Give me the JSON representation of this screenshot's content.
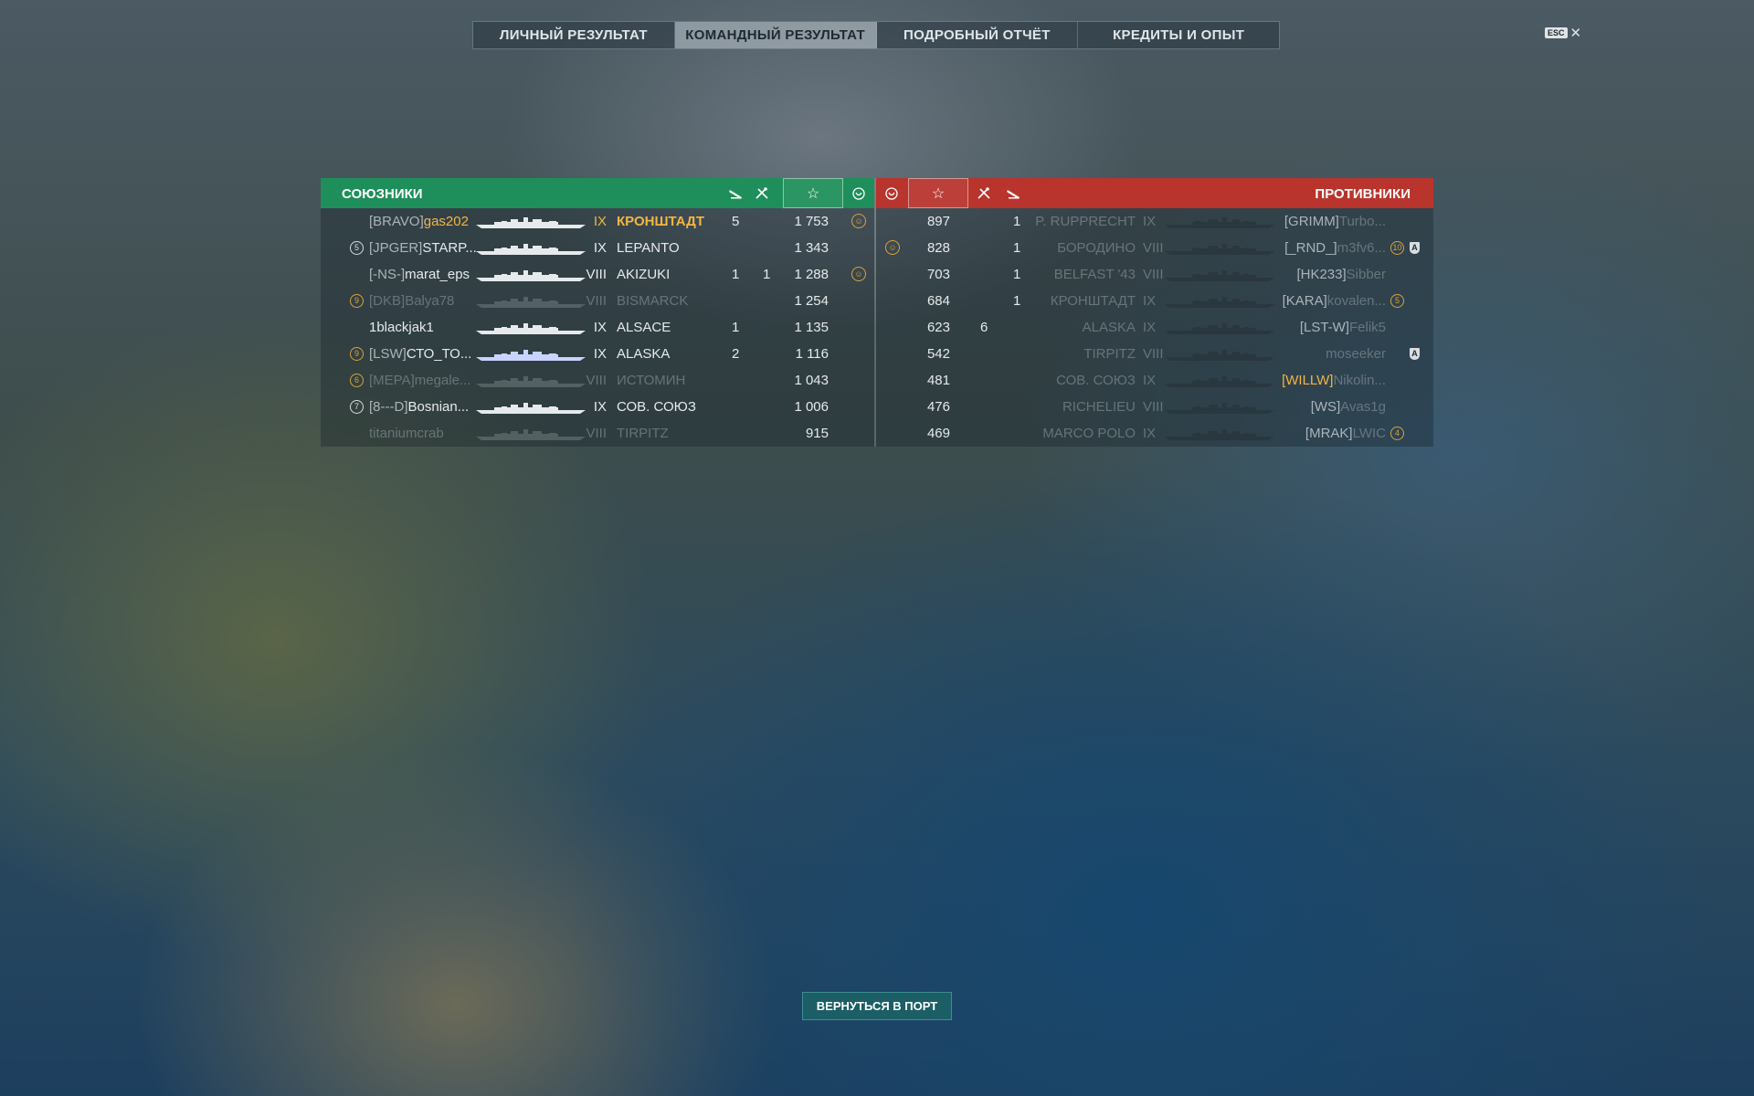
{
  "tabs": [
    "ЛИЧНЫЙ РЕЗУЛЬТАТ",
    "КОМАНДНЫЙ РЕЗУЛЬТАТ",
    "ПОДРОБНЫЙ ОТЧЁТ",
    "КРЕДИТЫ И ОПЫТ"
  ],
  "active_tab": "КОМАНДНЫЙ РЕЗУЛЬТАТ",
  "esc_label": "ESC",
  "close_glyph": "✕",
  "allies": {
    "title": "СОЮЗНИКИ",
    "header_color": "#1e8f5a",
    "rows": [
      {
        "badge": "",
        "clan": "[BRAVO]",
        "name": "gas202",
        "tier": "IX",
        "ship": "КРОНШТАДТ",
        "col_a": "5",
        "col_b": "",
        "score": "1 753",
        "medal": true,
        "style": "gold"
      },
      {
        "badge": "5",
        "clan": "[JPGER]",
        "name": "STARP...",
        "tier": "IX",
        "ship": "LEPANTO",
        "col_a": "",
        "col_b": "",
        "score": "1 343",
        "medal": false,
        "style": "normal",
        "badge_white": true
      },
      {
        "badge": "",
        "clan": "[-NS-]",
        "name": "marat_eps",
        "tier": "VIII",
        "ship": "AKIZUKI",
        "col_a": "1",
        "col_b": "1",
        "score": "1 288",
        "medal": true,
        "style": "normal"
      },
      {
        "badge": "9",
        "clan": "[DKB]",
        "name": "Balya78",
        "tier": "VIII",
        "ship": "BISMARCK",
        "col_a": "",
        "col_b": "",
        "score": "1 254",
        "medal": false,
        "style": "dead"
      },
      {
        "badge": "",
        "clan": "",
        "name": "1blackjak1",
        "tier": "IX",
        "ship": "ALSACE",
        "col_a": "1",
        "col_b": "",
        "score": "1 135",
        "medal": false,
        "style": "normal"
      },
      {
        "badge": "9",
        "clan": "[LSW]",
        "name": "СТО_ТО...",
        "tier": "IX",
        "ship": "ALASKA",
        "col_a": "2",
        "col_b": "",
        "score": "1 116",
        "medal": false,
        "style": "normal"
      },
      {
        "badge": "6",
        "clan": "[MEPA]",
        "name": "megale...",
        "tier": "VIII",
        "ship": "ИСТОМИН",
        "col_a": "",
        "col_b": "",
        "score": "1 043",
        "medal": false,
        "style": "dead"
      },
      {
        "badge": "7",
        "clan": "[8---D]",
        "name": "Bosnian...",
        "tier": "IX",
        "ship": "СОВ. СОЮЗ",
        "col_a": "",
        "col_b": "",
        "score": "1 006",
        "medal": false,
        "style": "normal",
        "badge_white": true
      },
      {
        "badge": "",
        "clan": "",
        "name": "titaniumcrab",
        "tier": "VIII",
        "ship": "TIRPITZ",
        "col_a": "",
        "col_b": "",
        "score": "915",
        "medal": false,
        "style": "dead"
      }
    ]
  },
  "enemies": {
    "title": "ПРОТИВНИКИ",
    "header_color": "#b8342d",
    "rows": [
      {
        "medal": false,
        "score": "897",
        "col_b": "",
        "col_a": "1",
        "ship": "P. RUPPRECHT",
        "tier": "IX",
        "clan": "[GRIMM]",
        "name": "Turbo...",
        "badge": "",
        "shield": false,
        "clan_style": "normal"
      },
      {
        "medal": true,
        "score": "828",
        "col_b": "",
        "col_a": "1",
        "ship": "БОРОДИНО",
        "tier": "VIII",
        "clan": "[_RND_]",
        "name": "m3fv6...",
        "badge": "10",
        "shield": true,
        "clan_style": "normal"
      },
      {
        "medal": false,
        "score": "703",
        "col_b": "",
        "col_a": "1",
        "ship": "BELFAST '43",
        "tier": "VIII",
        "clan": "[HK233]",
        "name": "Sibber",
        "badge": "",
        "shield": false,
        "clan_style": "normal"
      },
      {
        "medal": false,
        "score": "684",
        "col_b": "",
        "col_a": "1",
        "ship": "КРОНШТАДТ",
        "tier": "IX",
        "clan": "[KARA]",
        "name": "kovalen...",
        "badge": "5",
        "shield": false,
        "clan_style": "normal"
      },
      {
        "medal": false,
        "score": "623",
        "col_b": "6",
        "col_a": "",
        "ship": "ALASKA",
        "tier": "IX",
        "clan": "[LST-W]",
        "name": "Felik5",
        "badge": "",
        "shield": false,
        "clan_style": "normal"
      },
      {
        "medal": false,
        "score": "542",
        "col_b": "",
        "col_a": "",
        "ship": "TIRPITZ",
        "tier": "VIII",
        "clan": "",
        "name": "moseeker",
        "badge": "",
        "shield": true,
        "clan_style": "normal"
      },
      {
        "medal": false,
        "score": "481",
        "col_b": "",
        "col_a": "",
        "ship": "СОВ. СОЮЗ",
        "tier": "IX",
        "clan": "[WILLW]",
        "name": "Nikolin...",
        "badge": "",
        "shield": false,
        "clan_style": "gold"
      },
      {
        "medal": false,
        "score": "476",
        "col_b": "",
        "col_a": "",
        "ship": "RICHELIEU",
        "tier": "VIII",
        "clan": "[WS]",
        "name": "Avas1g",
        "badge": "",
        "shield": false,
        "clan_style": "normal"
      },
      {
        "medal": false,
        "score": "469",
        "col_b": "",
        "col_a": "",
        "ship": "MARCO POLO",
        "tier": "IX",
        "clan": "[MRAK]",
        "name": "LWIC",
        "badge": "4",
        "shield": false,
        "clan_style": "normal"
      }
    ]
  },
  "back_button": "ВЕРНУТЬСЯ В ПОРТ",
  "icons": {
    "torpedo": "torpedo-icon",
    "planes": "planes-shot-icon",
    "star": "star-icon",
    "kraken": "medal-icon"
  }
}
